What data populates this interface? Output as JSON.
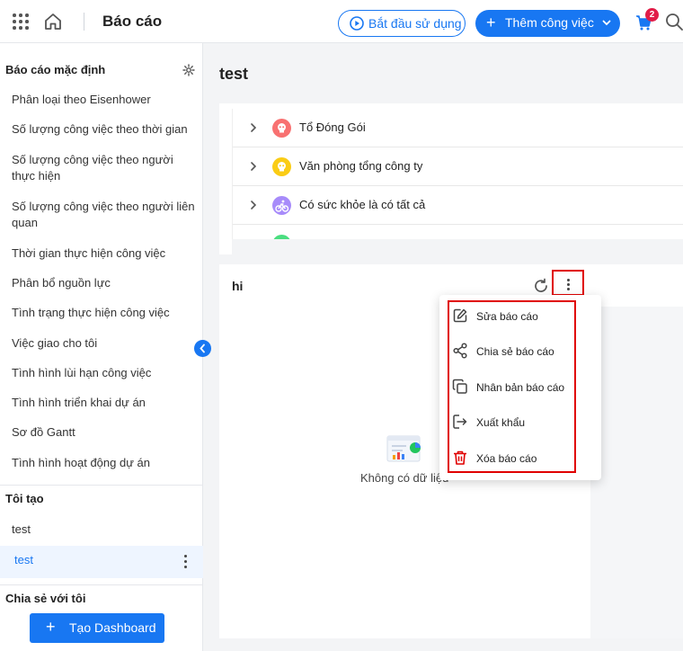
{
  "header": {
    "title": "Báo cáo",
    "start_label": "Bắt đầu sử dụng",
    "add_task_label": "Thêm công việc",
    "cart_count": "2"
  },
  "sidebar": {
    "default_heading": "Báo cáo mặc định",
    "default_items": [
      "Phân loại theo Eisenhower",
      "Số lượng công việc theo thời gian",
      "Số lượng công việc theo người thực hiện",
      "Số lượng công việc theo người liên quan",
      "Thời gian thực hiện công việc",
      "Phân bổ nguồn lực",
      "Tình trạng thực hiện công việc",
      "Việc giao cho tôi",
      "Tình hình lùi hạn công việc",
      "Tình hình triển khai dự án",
      "Sơ đồ Gantt",
      "Tình hình hoạt động dự án"
    ],
    "created_heading": "Tôi tạo",
    "created_items": [
      "test",
      "test"
    ],
    "shared_heading": "Chia sẻ với tôi",
    "create_dashboard_label": "Tạo Dashboard"
  },
  "main": {
    "title": "test",
    "groups": [
      {
        "label": "Tổ Đóng Gói",
        "color": "#f87171"
      },
      {
        "label": "Văn phòng tổng công ty",
        "color": "#facc15"
      },
      {
        "label": "Có sức khỏe là có tất cả",
        "color": "#a78bfa"
      }
    ],
    "report": {
      "title": "hi",
      "empty_text": "Không có dữ liệu"
    },
    "menu": [
      {
        "label": "Sửa báo cáo",
        "icon": "edit-icon"
      },
      {
        "label": "Chia sẻ báo cáo",
        "icon": "share-icon"
      },
      {
        "label": "Nhân bản báo cáo",
        "icon": "copy-icon"
      },
      {
        "label": "Xuất khẩu",
        "icon": "export-icon"
      },
      {
        "label": "Xóa báo cáo",
        "icon": "trash-icon"
      }
    ]
  },
  "colors": {
    "accent": "#1877f2",
    "highlight": "#e00000",
    "badge": "#e11d48"
  }
}
